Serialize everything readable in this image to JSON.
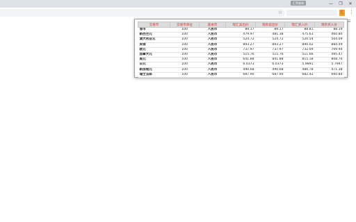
{
  "window": {
    "label": "汇率查询",
    "controls": [
      "—",
      "❐",
      "✕"
    ]
  },
  "toolbar": {
    "star": "☆",
    "extension_label": "汇",
    "menu": "⋮",
    "apps": "☷"
  },
  "table": {
    "headers": [
      "交易币",
      "交易币单位",
      "基本币",
      "现汇卖出价",
      "现钞卖出价",
      "现汇买入价",
      "现钞买入价"
    ],
    "rows": [
      [
        "港币",
        "100",
        "人民币",
        "89.17",
        "89.17",
        "88.81",
        "88.19"
      ],
      [
        "新西兰元",
        "100",
        "人民币",
        "479.97",
        "481.38",
        "475.63",
        "460.80"
      ],
      [
        "澳大利亚元",
        "100",
        "人民币",
        "524.72",
        "524.72",
        "520.54",
        "504.09"
      ],
      [
        "英镑",
        "100",
        "人民币",
        "893.27",
        "893.27",
        "890.02",
        "884.49"
      ],
      [
        "欧元",
        "100",
        "人民币",
        "737.97",
        "737.97",
        "732.09",
        "709.94"
      ],
      [
        "加拿大元",
        "100",
        "人民币",
        "515.76",
        "515.76",
        "511.66",
        "495.47"
      ],
      [
        "美元",
        "100",
        "人民币",
        "641.88",
        "841.88",
        "815.18",
        "808.76"
      ],
      [
        "日元",
        "100",
        "人民币",
        "6.0373",
        "6.0373",
        "5.9891",
        "5.7947"
      ],
      [
        "新加坡元",
        "100",
        "人民币",
        "490.68",
        "490.68",
        "486.78",
        "471.38"
      ],
      [
        "瑞士法郎",
        "100",
        "人民币",
        "687.90",
        "687.90",
        "682.42",
        "660.84"
      ]
    ]
  }
}
